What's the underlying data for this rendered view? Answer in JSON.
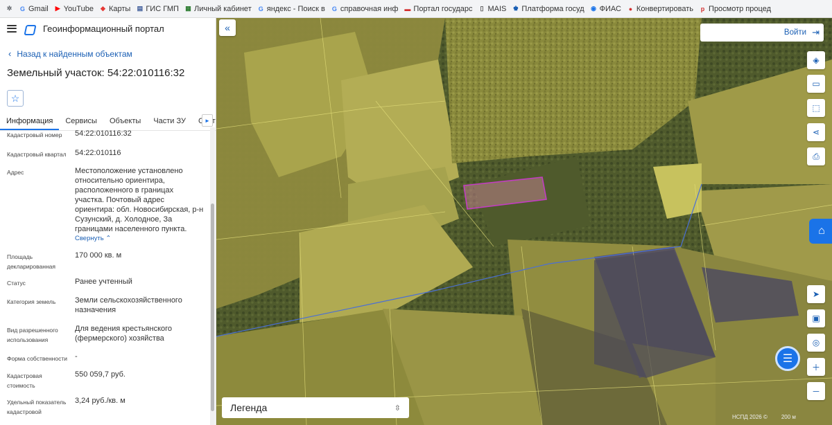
{
  "bookmarks": [
    {
      "label": "",
      "icon": "extension-icon",
      "color": "#5f6368"
    },
    {
      "label": "Gmail",
      "icon": "google-icon",
      "color": "#4285f4"
    },
    {
      "label": "YouTube",
      "icon": "youtube-icon",
      "color": "#ff0000"
    },
    {
      "label": "Карты",
      "icon": "maps-icon",
      "color": "#e53935"
    },
    {
      "label": "ГИС ГМП",
      "icon": "gis-gmp-icon",
      "color": "#3b5998"
    },
    {
      "label": "Личный кабинет",
      "icon": "cabinet-icon",
      "color": "#2e7d32"
    },
    {
      "label": "яндекс - Поиск в ",
      "icon": "google-icon",
      "color": "#4285f4"
    },
    {
      "label": "справочная инф",
      "icon": "google-icon",
      "color": "#4285f4"
    },
    {
      "label": "Портал государс",
      "icon": "flag-icon",
      "color": "#d32f2f"
    },
    {
      "label": "MAIS",
      "icon": "document-icon",
      "color": "#555555"
    },
    {
      "label": "Платформа госуд",
      "icon": "emblem-icon",
      "color": "#1a5fb4"
    },
    {
      "label": "ФИАС",
      "icon": "fias-icon",
      "color": "#1a73e8"
    },
    {
      "label": "Конвертировать ",
      "icon": "convert-icon",
      "color": "#d32f2f"
    },
    {
      "label": "Просмотр процед",
      "icon": "rts-icon",
      "color": "#d32f2f"
    }
  ],
  "header": {
    "title": "Геоинформационный портал"
  },
  "back_link": "Назад к найденным объектам",
  "parcel_title": "Земельный участок: 54:22:010116:32",
  "tabs": [
    "Информация",
    "Сервисы",
    "Объекты",
    "Части ЗУ",
    "Состав"
  ],
  "fields": {
    "cadastral_number": {
      "label": "Кадастровый номер",
      "value": "54:22:010116:32"
    },
    "cadastral_quarter": {
      "label": "Кадастровый квартал",
      "value": "54:22:010116"
    },
    "address": {
      "label": "Адрес",
      "value": "Местоположение установлено относительно ориентира, расположенного в границах участка. Почтовый адрес ориентира: обл. Новосибирская, р-н Сузунский, д. Холодное, За границами населенного пункта.",
      "collapse": "Свернуть"
    },
    "area": {
      "label": "Площадь декларированная",
      "value": "170 000 кв. м"
    },
    "status": {
      "label": "Статус",
      "value": "Ранее учтенный"
    },
    "category": {
      "label": "Категория земель",
      "value": "Земли сельскохозяйственного назначения"
    },
    "permitted_use": {
      "label": "Вид разрешенного использования",
      "value": "Для ведения крестьянского (фермерского) хозяйства"
    },
    "ownership": {
      "label": "Форма собственности",
      "value": "-"
    },
    "cadastral_value": {
      "label": "Кадастровая стоимость",
      "value": "550 059,7 руб."
    },
    "specific_value": {
      "label": "Удельный показатель кадастровой",
      "value": "3,24 руб./кв. м"
    }
  },
  "map": {
    "login_label": "Войти",
    "legend_label": "Легенда",
    "footer_left": "НСПД 2026 ©",
    "scale": "200 м",
    "colors": {
      "accent": "#1a73e8",
      "highlight": "#c33cc3",
      "boundary": "#4a6fd6"
    }
  }
}
